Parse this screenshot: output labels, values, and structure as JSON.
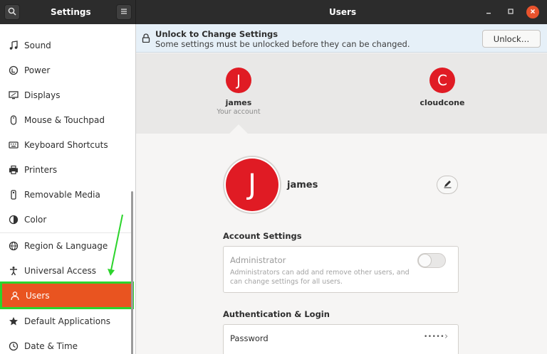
{
  "header": {
    "app_title": "Settings",
    "window_title": "Users",
    "search_icon": "search-icon",
    "menu_icon": "hamburger-menu-icon",
    "minimize_icon": "minimize-icon",
    "maximize_icon": "maximize-icon",
    "close_icon": "close-icon",
    "close_color": "#e9532d"
  },
  "sidebar": {
    "items": [
      {
        "label": "Sound",
        "icon": "music-note-icon"
      },
      {
        "label": "Power",
        "icon": "power-icon"
      },
      {
        "label": "Displays",
        "icon": "display-icon"
      },
      {
        "label": "Mouse & Touchpad",
        "icon": "mouse-icon"
      },
      {
        "label": "Keyboard Shortcuts",
        "icon": "keyboard-icon"
      },
      {
        "label": "Printers",
        "icon": "printer-icon"
      },
      {
        "label": "Removable Media",
        "icon": "removable-media-icon"
      },
      {
        "label": "Color",
        "icon": "color-icon"
      },
      {
        "label": "Region & Language",
        "icon": "globe-icon"
      },
      {
        "label": "Universal Access",
        "icon": "accessibility-icon"
      },
      {
        "label": "Users",
        "icon": "user-icon",
        "active": true
      },
      {
        "label": "Default Applications",
        "icon": "star-icon"
      },
      {
        "label": "Date & Time",
        "icon": "clock-icon"
      }
    ],
    "active_color": "#e95420",
    "highlight_color": "#2cd42c"
  },
  "unlock": {
    "title": "Unlock to Change Settings",
    "subtitle": "Some settings must be unlocked before they can be changed.",
    "button_label": "Unlock…"
  },
  "users": [
    {
      "initial": "J",
      "name": "james",
      "subtitle": "Your account"
    },
    {
      "initial": "C",
      "name": "cloudcone",
      "subtitle": ""
    }
  ],
  "selected_user": {
    "initial": "J",
    "name": "james",
    "avatar_color": "#e01b24"
  },
  "account_settings": {
    "heading": "Account Settings",
    "administrator_label": "Administrator",
    "administrator_description": "Administrators can add and remove other users, and can change settings for all users.",
    "administrator_enabled": false
  },
  "auth": {
    "heading": "Authentication & Login",
    "password_label": "Password",
    "password_value": "•••••"
  }
}
